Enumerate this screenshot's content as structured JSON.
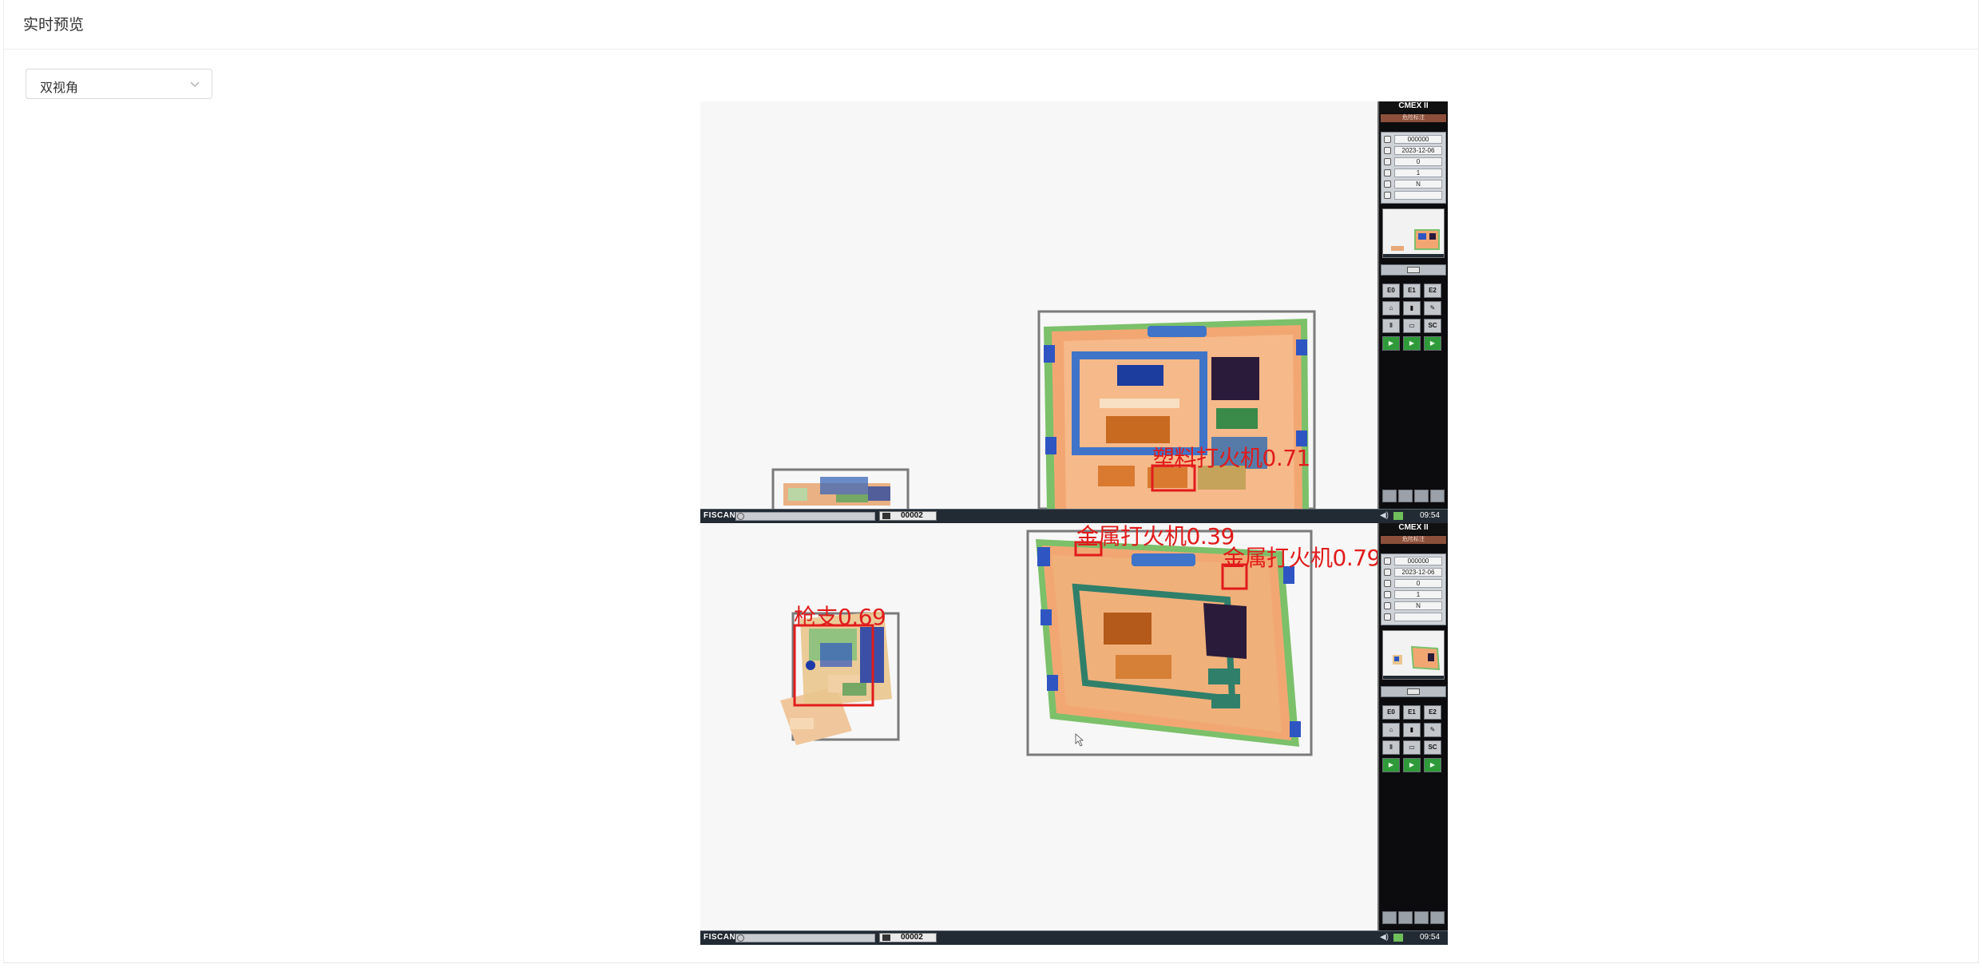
{
  "header": {
    "title": "实时预览"
  },
  "view_select": {
    "value": "双视角",
    "icon": "chevron-down-icon"
  },
  "panes": [
    {
      "status": {
        "brand": "FISCAN",
        "counter": "00002",
        "time": "09:54"
      },
      "side": {
        "title": "CMEX II",
        "mode": "危险标注",
        "info": [
          "000000",
          "2023-12-06",
          "0",
          "1",
          "N",
          ""
        ],
        "buttons": [
          "E0",
          "E1",
          "E2",
          "",
          "",
          "",
          "",
          "",
          "SC",
          "",
          "",
          ""
        ]
      },
      "detections": [
        {
          "label": "塑料打火机0.71"
        }
      ]
    },
    {
      "status": {
        "brand": "FISCAN",
        "counter": "00002",
        "time": "09:54"
      },
      "side": {
        "title": "CMEX II",
        "mode": "危险标注",
        "info": [
          "000000",
          "2023-12-06",
          "0",
          "1",
          "N",
          ""
        ],
        "buttons": [
          "E0",
          "E1",
          "E2",
          "",
          "",
          "",
          "",
          "",
          "SC",
          "",
          "",
          ""
        ]
      },
      "detections": [
        {
          "label": "金属打火机0.39"
        },
        {
          "label": "金属打火机0.79"
        },
        {
          "label": "枪支0.69"
        }
      ]
    }
  ],
  "colors": {
    "detection_box": "#e11b1b",
    "object_box": "#7a7a7a"
  }
}
